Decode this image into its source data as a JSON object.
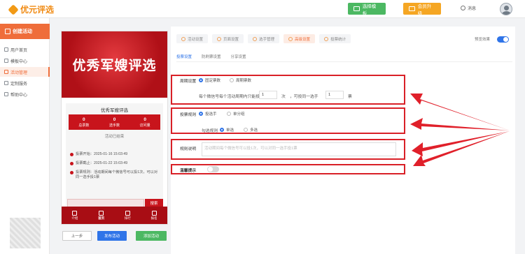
{
  "topbar": {
    "logo": "优元评选",
    "template_btn": "选择模板",
    "vip_btn": "会员升级",
    "msg": "消息"
  },
  "sidebar": {
    "create": "创建活动",
    "items": [
      {
        "label": "用户首页",
        "icon": "home-icon"
      },
      {
        "label": "模板中心",
        "icon": "folder-icon"
      },
      {
        "label": "活动管理",
        "icon": "list-icon",
        "active": true
      },
      {
        "label": "定制服务",
        "icon": "service-icon"
      },
      {
        "label": "帮助中心",
        "icon": "help-icon"
      }
    ]
  },
  "preview": {
    "banner_title": "优秀军嫂评选",
    "card_title": "优秀军嫂评选",
    "stats": [
      {
        "value": "0",
        "label": "总票数"
      },
      {
        "value": "0",
        "label": "选手数"
      },
      {
        "value": "0",
        "label": "访问量"
      }
    ],
    "ended": "活动已结束",
    "info": [
      "投票开始：2025-01-16 15:03:49",
      "投票截止：2025-01-22 15:03:49",
      "投票规则：活动期间每个微信号可以投1次，可以对同一选手投1票"
    ],
    "vote_btn": "搜索",
    "tabs": [
      "介绍",
      "首页",
      "排行",
      "报名"
    ]
  },
  "bottom": {
    "prev": "上一步",
    "publish": "发布活动",
    "add": "添加活动"
  },
  "steps": [
    "活动设置",
    "页面设置",
    "选手管理",
    "高级设置",
    "投票统计"
  ],
  "preview_label": "预览效果",
  "subtabs": [
    "投票设置",
    "防刷票设置",
    "分享设置"
  ],
  "cycle": {
    "label": "周期设置",
    "opt1": "固定票数",
    "opt2": "周期票数",
    "desc1": "每个微信号每个活动周期内只能投",
    "times_value": "1",
    "times_unit": "次",
    "desc2": "，可投同一选手",
    "votes_value": "1",
    "votes_unit": "票"
  },
  "rule": {
    "label": "投票规则",
    "opt1": "投选手",
    "opt2": "单分组",
    "sub_label": "勾选规则",
    "sub_opt1": "单选",
    "sub_opt2": "多选"
  },
  "desc": {
    "label": "规则说明",
    "placeholder": "活动期间每个微信号可以投1次，可以对同一选手投1票"
  },
  "tip": {
    "label": "温馨提示"
  }
}
